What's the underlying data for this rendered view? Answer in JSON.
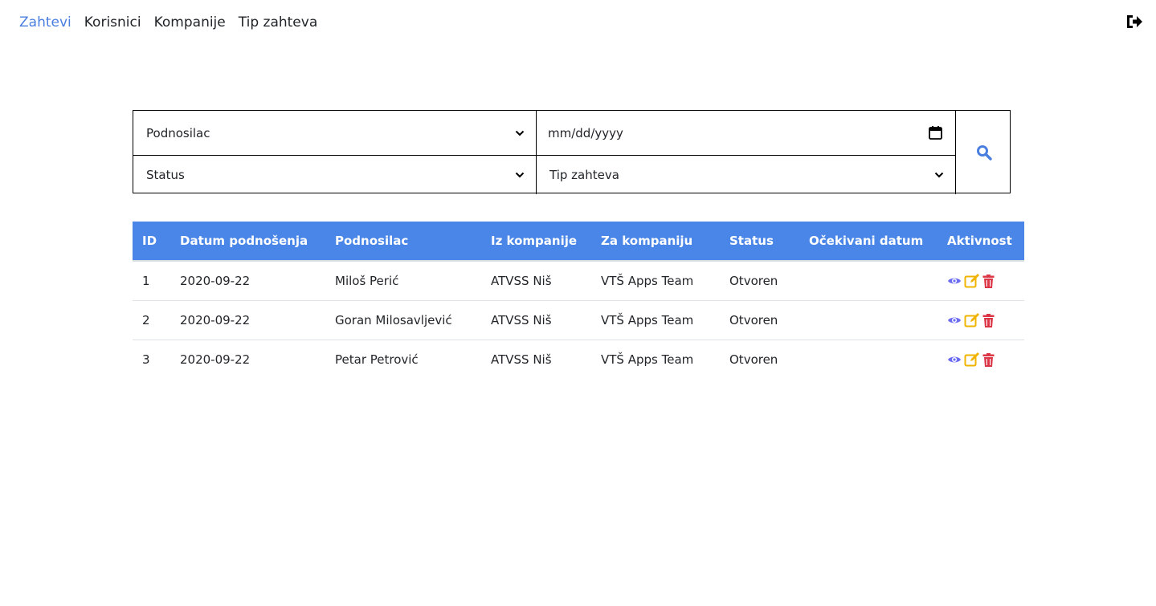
{
  "nav": {
    "items": [
      {
        "label": "Zahtevi",
        "active": true
      },
      {
        "label": "Korisnici",
        "active": false
      },
      {
        "label": "Kompanije",
        "active": false
      },
      {
        "label": "Tip zahteva",
        "active": false
      }
    ],
    "logout_icon": "sign-out-icon"
  },
  "filters": {
    "podnosilac": "Podnosilac",
    "date_placeholder": "mm/dd/yyyy",
    "status": "Status",
    "tip_zahteva": "Tip zahteva",
    "search_icon": "search-icon"
  },
  "table": {
    "headers": [
      "ID",
      "Datum podnošenja",
      "Podnosilac",
      "Iz kompanije",
      "Za kompaniju",
      "Status",
      "Očekivani datum",
      "Aktivnost"
    ],
    "rows": [
      {
        "id": "1",
        "datum": "2020-09-22",
        "podnosilac": "Miloš Perić",
        "iz": "ATVSS Niš",
        "za": "VTŠ Apps Team",
        "status": "Otvoren",
        "ocekivani": ""
      },
      {
        "id": "2",
        "datum": "2020-09-22",
        "podnosilac": "Goran Milosavljević",
        "iz": "ATVSS Niš",
        "za": "VTŠ Apps Team",
        "status": "Otvoren",
        "ocekivani": ""
      },
      {
        "id": "3",
        "datum": "2020-09-22",
        "podnosilac": "Petar Petrović",
        "iz": "ATVSS Niš",
        "za": "VTŠ Apps Team",
        "status": "Otvoren",
        "ocekivani": ""
      }
    ],
    "action_icons": [
      "eye-icon",
      "edit-icon",
      "trash-icon"
    ]
  },
  "colors": {
    "accent": "#4a86e8",
    "nav_active": "#4a7fe0",
    "view_icon": "#6c6cf0",
    "edit_icon": "#f0b400",
    "delete_icon": "#dc3545"
  }
}
